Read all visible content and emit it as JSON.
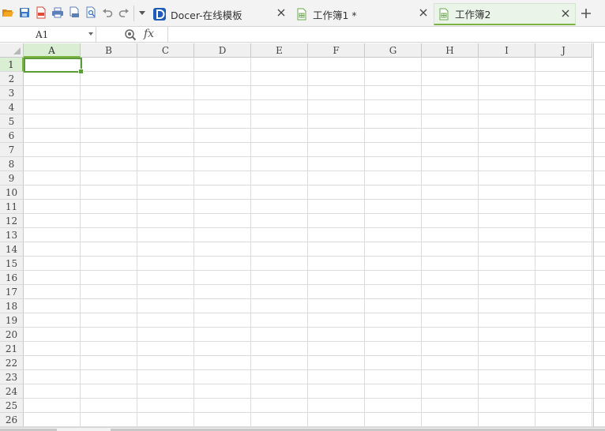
{
  "toolbar": {
    "icons": [
      "open-folder-icon",
      "save-icon",
      "export-pdf-icon",
      "print-icon",
      "print-preview-icon",
      "find-icon",
      "undo-icon",
      "redo-icon",
      "customize-dropdown-icon"
    ],
    "colors": {
      "folder": "#f0a020",
      "save": "#3b78c8",
      "pdf": "#e04a3a",
      "print": "#5b7fb8",
      "accent": "#7cb342"
    }
  },
  "tabs": [
    {
      "label": "Docer-在线模板",
      "icon": "docer-icon",
      "active": false
    },
    {
      "label": "工作簿1 *",
      "icon": "spreadsheet-icon",
      "active": false
    },
    {
      "label": "工作簿2",
      "icon": "spreadsheet-icon",
      "active": true
    }
  ],
  "formula_bar": {
    "cell_ref": "A1",
    "fx_label": "fx",
    "formula_value": ""
  },
  "grid": {
    "columns": [
      "A",
      "B",
      "C",
      "D",
      "E",
      "F",
      "G",
      "H",
      "I",
      "J"
    ],
    "rows": [
      "1",
      "2",
      "3",
      "4",
      "5",
      "6",
      "7",
      "8",
      "9",
      "10",
      "11",
      "12",
      "13",
      "14",
      "15",
      "16",
      "17",
      "18",
      "19",
      "20",
      "21",
      "22",
      "23",
      "24",
      "25",
      "26"
    ],
    "selected_column": "A",
    "selected_row": "1"
  }
}
